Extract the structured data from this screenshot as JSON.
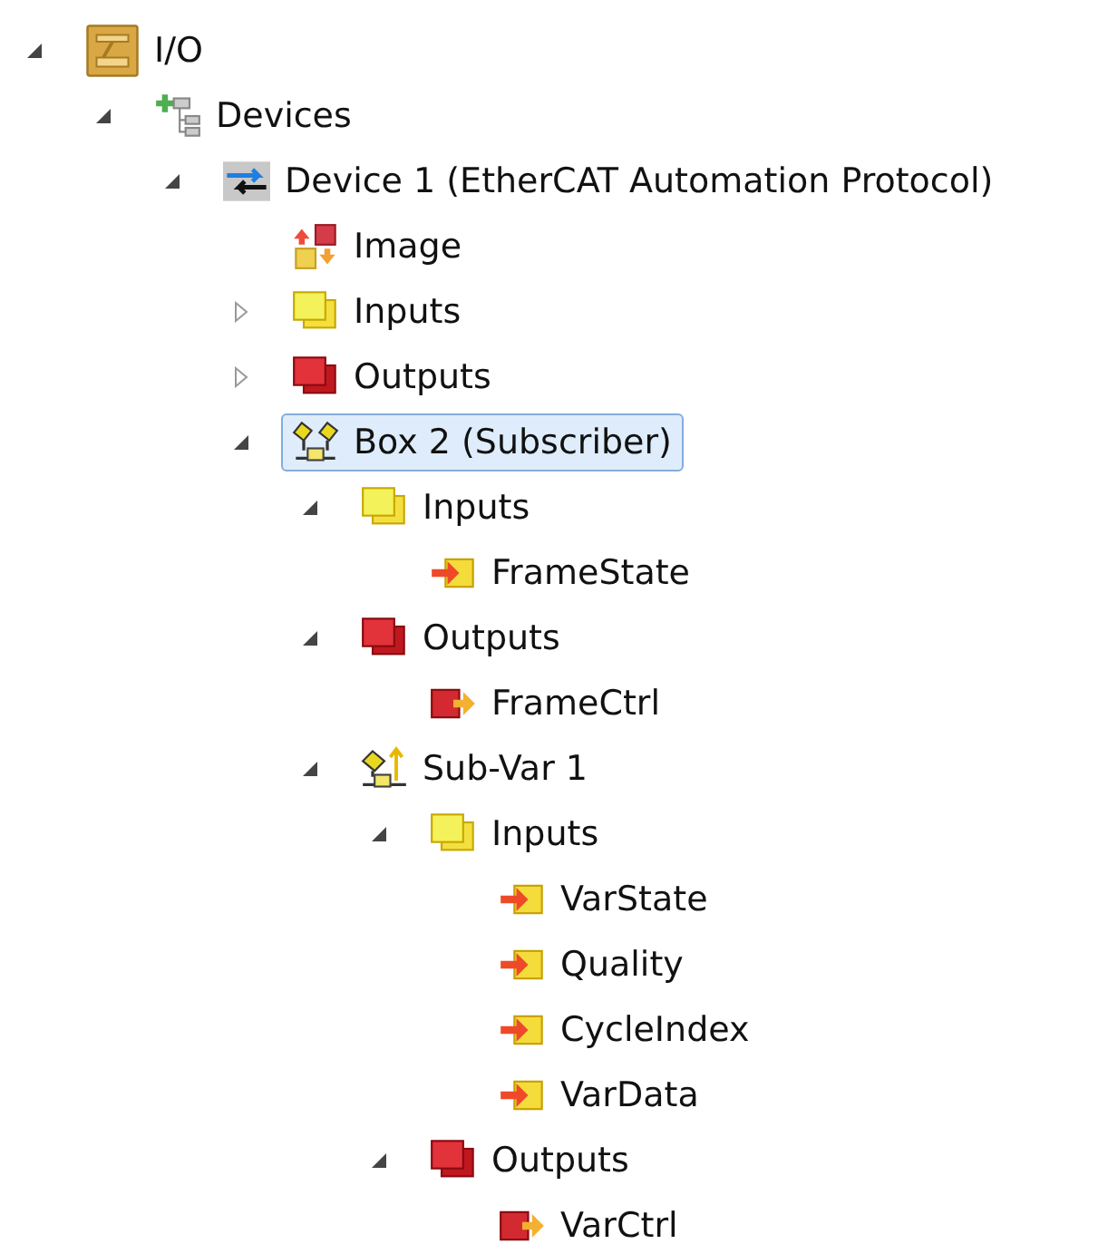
{
  "tree": [
    {
      "label": "I/O",
      "kind": "io",
      "expanded": true,
      "selected": false,
      "children": [
        {
          "label": "Devices",
          "kind": "devices",
          "expanded": true,
          "selected": false,
          "children": [
            {
              "label": "Device 1 (EtherCAT Automation Protocol)",
              "kind": "device",
              "expanded": true,
              "selected": false,
              "children": [
                {
                  "label": "Image",
                  "kind": "image",
                  "selected": false
                },
                {
                  "label": "Inputs",
                  "kind": "inputs",
                  "expanded": false,
                  "selected": false
                },
                {
                  "label": "Outputs",
                  "kind": "outputs",
                  "expanded": false,
                  "selected": false
                },
                {
                  "label": "Box 2 (Subscriber)",
                  "kind": "box",
                  "expanded": true,
                  "selected": true,
                  "children": [
                    {
                      "label": "Inputs",
                      "kind": "inputs",
                      "expanded": true,
                      "selected": false,
                      "children": [
                        {
                          "label": "FrameState",
                          "kind": "input_var",
                          "selected": false
                        }
                      ]
                    },
                    {
                      "label": "Outputs",
                      "kind": "outputs",
                      "expanded": true,
                      "selected": false,
                      "children": [
                        {
                          "label": "FrameCtrl",
                          "kind": "output_var",
                          "selected": false
                        }
                      ]
                    },
                    {
                      "label": "Sub-Var 1",
                      "kind": "subvar",
                      "expanded": true,
                      "selected": false,
                      "children": [
                        {
                          "label": "Inputs",
                          "kind": "inputs",
                          "expanded": true,
                          "selected": false,
                          "children": [
                            {
                              "label": "VarState",
                              "kind": "input_var",
                              "selected": false
                            },
                            {
                              "label": "Quality",
                              "kind": "input_var",
                              "selected": false
                            },
                            {
                              "label": "CycleIndex",
                              "kind": "input_var",
                              "selected": false
                            },
                            {
                              "label": "VarData",
                              "kind": "input_var",
                              "selected": false
                            }
                          ]
                        },
                        {
                          "label": "Outputs",
                          "kind": "outputs",
                          "expanded": true,
                          "selected": false,
                          "children": [
                            {
                              "label": "VarCtrl",
                              "kind": "output_var",
                              "selected": false
                            }
                          ]
                        }
                      ]
                    }
                  ]
                }
              ]
            }
          ]
        }
      ]
    }
  ]
}
